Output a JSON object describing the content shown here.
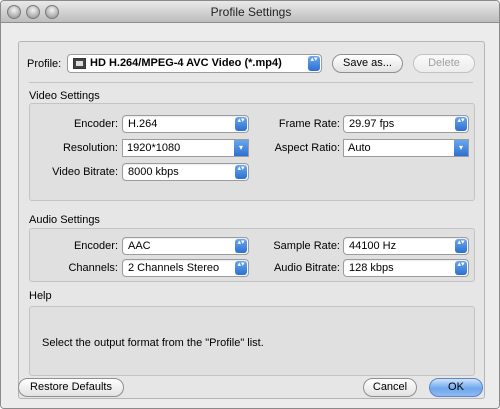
{
  "window": {
    "title": "Profile Settings"
  },
  "profile": {
    "label": "Profile:",
    "value": "HD H.264/MPEG-4 AVC Video (*.mp4)",
    "save_as_label": "Save as...",
    "delete_label": "Delete"
  },
  "video": {
    "title": "Video Settings",
    "encoder_label": "Encoder:",
    "encoder_value": "H.264",
    "resolution_label": "Resolution:",
    "resolution_value": "1920*1080",
    "bitrate_label": "Video Bitrate:",
    "bitrate_value": "8000 kbps",
    "framerate_label": "Frame Rate:",
    "framerate_value": "29.97 fps",
    "aspect_label": "Aspect Ratio:",
    "aspect_value": "Auto"
  },
  "audio": {
    "title": "Audio Settings",
    "encoder_label": "Encoder:",
    "encoder_value": "AAC",
    "channels_label": "Channels:",
    "channels_value": "2 Channels Stereo",
    "samplerate_label": "Sample Rate:",
    "samplerate_value": "44100 Hz",
    "bitrate_label": "Audio Bitrate:",
    "bitrate_value": "128 kbps"
  },
  "help": {
    "title": "Help",
    "text": "Select the output format from the \"Profile\" list."
  },
  "footer": {
    "restore_label": "Restore Defaults",
    "cancel_label": "Cancel",
    "ok_label": "OK"
  },
  "icons": {
    "popup_arrows": "▴▾",
    "combo_arrow": "▾"
  }
}
